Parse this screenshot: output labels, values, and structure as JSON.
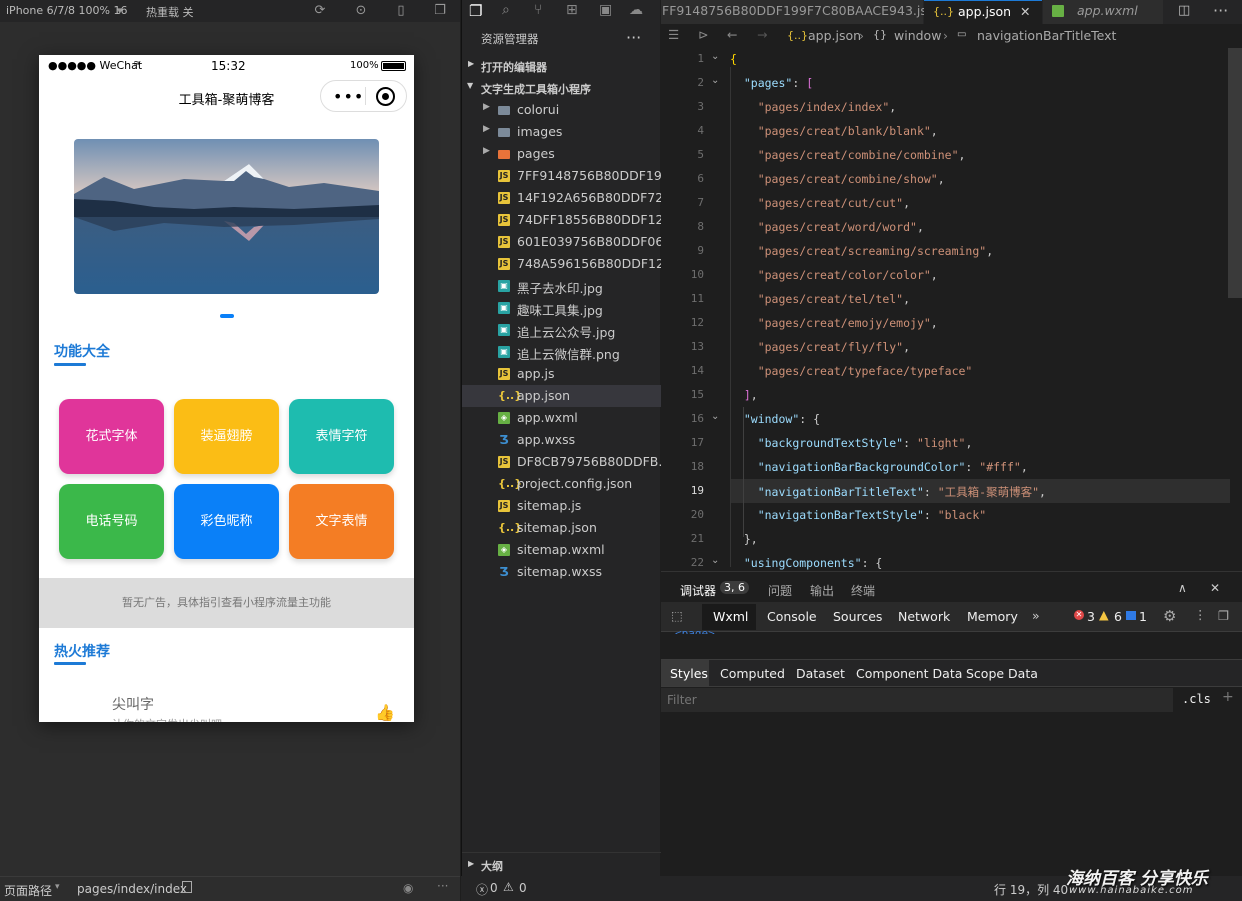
{
  "sim_toolbar": {
    "device": "iPhone 6/7/8 100% 16",
    "reload": "热重载 关"
  },
  "phone": {
    "status": {
      "carrier": "●●●●● WeChat",
      "time": "15:32",
      "battery": "100%"
    },
    "nav_title": "工具箱-聚萌博客",
    "section1": "功能大全",
    "buttons": [
      {
        "label": "花式字体",
        "color": "#e0359a"
      },
      {
        "label": "装逼翅膀",
        "color": "#fbbd15"
      },
      {
        "label": "表情字符",
        "color": "#1ebcaf"
      },
      {
        "label": "电话号码",
        "color": "#3bb84a"
      },
      {
        "label": "彩色昵称",
        "color": "#0a80f8"
      },
      {
        "label": "文字表情",
        "color": "#f47d24"
      }
    ],
    "ad": "暂无广告，具体指引查看小程序流量主功能",
    "section2": "热火推荐",
    "item_title": "尖叫字",
    "item_sub": "让你的文字发出尖叫吧"
  },
  "sim_footer": {
    "label": "页面路径",
    "path": "pages/index/index"
  },
  "explorer": {
    "title": "资源管理器",
    "open_editors": "打开的编辑器",
    "project": "文字生成工具箱小程序",
    "outline": "大纲",
    "files": [
      {
        "name": "colorui",
        "type": "dir"
      },
      {
        "name": "images",
        "type": "dir"
      },
      {
        "name": "pages",
        "type": "dir"
      },
      {
        "name": "7FF9148756B80DDF19...",
        "type": "js"
      },
      {
        "name": "14F192A656B80DDF72...",
        "type": "js"
      },
      {
        "name": "74DFF18556B80DDF12...",
        "type": "js"
      },
      {
        "name": "601E039756B80DDF06...",
        "type": "js"
      },
      {
        "name": "748A596156B80DDF12...",
        "type": "js"
      },
      {
        "name": "黑子去水印.jpg",
        "type": "img"
      },
      {
        "name": "趣味工具集.jpg",
        "type": "img"
      },
      {
        "name": "追上云公众号.jpg",
        "type": "img"
      },
      {
        "name": "追上云微信群.png",
        "type": "img"
      },
      {
        "name": "app.js",
        "type": "js"
      },
      {
        "name": "app.json",
        "type": "json"
      },
      {
        "name": "app.wxml",
        "type": "wx"
      },
      {
        "name": "app.wxss",
        "type": "wxss"
      },
      {
        "name": "DF8CB79756B80DDFB...",
        "type": "js"
      },
      {
        "name": "project.config.json",
        "type": "json"
      },
      {
        "name": "sitemap.js",
        "type": "js"
      },
      {
        "name": "sitemap.json",
        "type": "json"
      },
      {
        "name": "sitemap.wxml",
        "type": "wx"
      },
      {
        "name": "sitemap.wxss",
        "type": "wxss"
      }
    ]
  },
  "editor": {
    "tabs": [
      "FF9148756B80DDF199F7C80BAACE943.js",
      "app.json",
      "app.wxml"
    ],
    "breadcrumb": [
      "app.json",
      "window",
      "navigationBarTitleText"
    ],
    "lines": [
      {
        "n": "1",
        "t": "{"
      },
      {
        "n": "2",
        "t": "  \"pages\": ["
      },
      {
        "n": "3",
        "t": "    \"pages/index/index\","
      },
      {
        "n": "4",
        "t": "    \"pages/creat/blank/blank\","
      },
      {
        "n": "5",
        "t": "    \"pages/creat/combine/combine\","
      },
      {
        "n": "6",
        "t": "    \"pages/creat/combine/show\","
      },
      {
        "n": "7",
        "t": "    \"pages/creat/cut/cut\","
      },
      {
        "n": "8",
        "t": "    \"pages/creat/word/word\","
      },
      {
        "n": "9",
        "t": "    \"pages/creat/screaming/screaming\","
      },
      {
        "n": "10",
        "t": "    \"pages/creat/color/color\","
      },
      {
        "n": "11",
        "t": "    \"pages/creat/tel/tel\","
      },
      {
        "n": "12",
        "t": "    \"pages/creat/emojy/emojy\","
      },
      {
        "n": "13",
        "t": "    \"pages/creat/fly/fly\","
      },
      {
        "n": "14",
        "t": "    \"pages/creat/typeface/typeface\""
      },
      {
        "n": "15",
        "t": "  ],"
      },
      {
        "n": "16",
        "t": "  \"window\": {"
      },
      {
        "n": "17",
        "t": "    \"backgroundTextStyle\": \"light\","
      },
      {
        "n": "18",
        "t": "    \"navigationBarBackgroundColor\": \"#fff\","
      },
      {
        "n": "19",
        "t": "    \"navigationBarTitleText\": \"工具箱-聚萌博客\","
      },
      {
        "n": "20",
        "t": "    \"navigationBarTextStyle\": \"black\""
      },
      {
        "n": "21",
        "t": "  },"
      },
      {
        "n": "22",
        "t": "  \"usingComponents\": {"
      }
    ]
  },
  "devtools": {
    "panel_tabs": [
      "调试器",
      "问题",
      "输出",
      "终端"
    ],
    "badge": "3, 6",
    "tool_tabs": [
      "Wxml",
      "Console",
      "Sources",
      "Network",
      "Memory"
    ],
    "errors": "3",
    "warnings": "6",
    "infos": "1",
    "page_tag": "<page>",
    "sub_tabs": [
      "Styles",
      "Computed",
      "Dataset",
      "Component Data",
      "Scope Data"
    ],
    "filter_placeholder": "Filter",
    "cls": ".cls"
  },
  "status_bottom": {
    "errors": "0",
    "warnings": "0",
    "position": "行 19，列 40",
    "watermark": "海纳百客 分享快乐",
    "watermark_url": "www.hainabaike.com"
  }
}
